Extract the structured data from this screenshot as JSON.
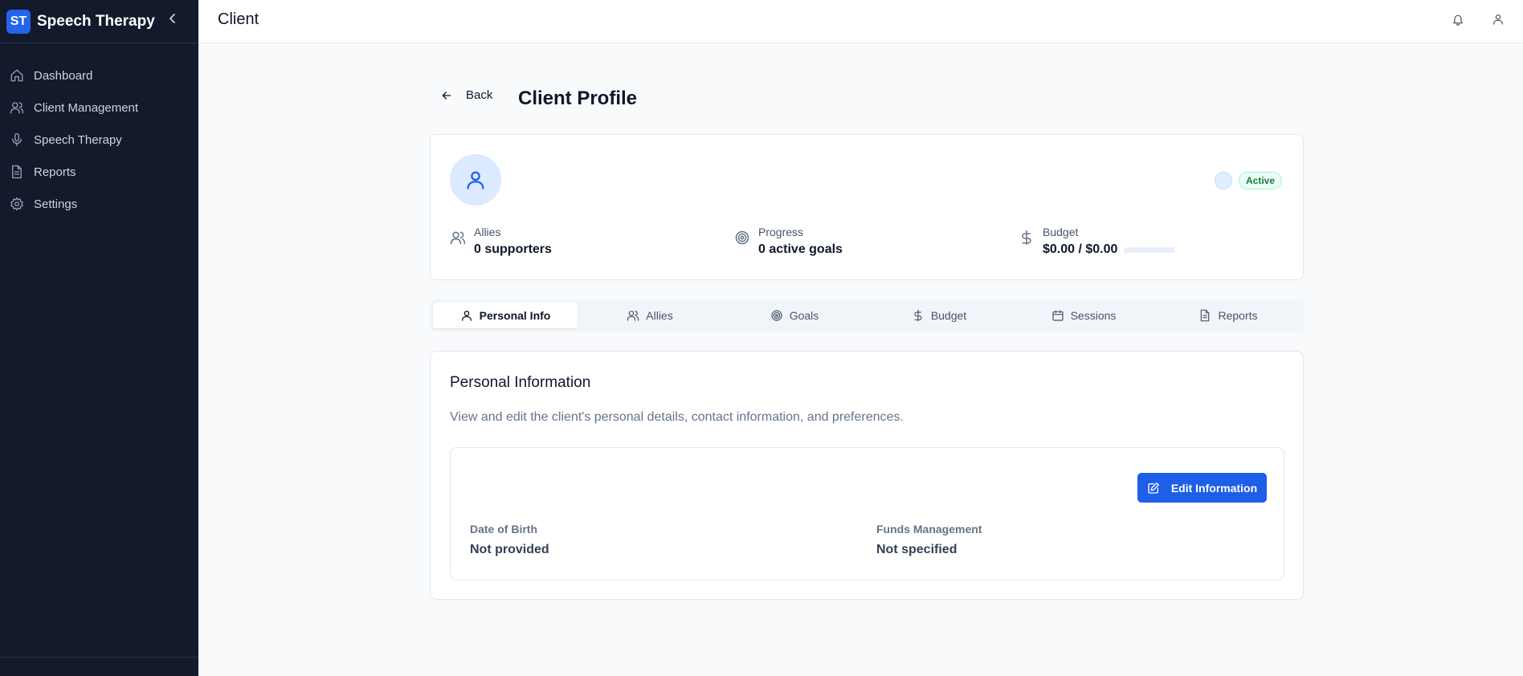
{
  "sidebar": {
    "logo": "ST",
    "app_name": "Speech Therapy",
    "items": [
      {
        "label": "Dashboard",
        "icon": "home-icon"
      },
      {
        "label": "Client Management",
        "icon": "users-icon"
      },
      {
        "label": "Speech Therapy",
        "icon": "mic-icon"
      },
      {
        "label": "Reports",
        "icon": "file-icon"
      },
      {
        "label": "Settings",
        "icon": "gear-icon"
      }
    ]
  },
  "header": {
    "title": "Client"
  },
  "page": {
    "back_label": "Back",
    "title": "Client Profile"
  },
  "profile": {
    "status": "Active",
    "stats": {
      "allies": {
        "label": "Allies",
        "value": "0 supporters"
      },
      "progress": {
        "label": "Progress",
        "value": "0 active goals"
      },
      "budget": {
        "label": "Budget",
        "value": "$0.00 / $0.00",
        "fill_fraction": 0
      }
    }
  },
  "tabs": [
    {
      "label": "Personal Info",
      "icon": "user-icon",
      "active": true
    },
    {
      "label": "Allies",
      "icon": "users-icon",
      "active": false
    },
    {
      "label": "Goals",
      "icon": "target-icon",
      "active": false
    },
    {
      "label": "Budget",
      "icon": "dollar-icon",
      "active": false
    },
    {
      "label": "Sessions",
      "icon": "calendar-icon",
      "active": false
    },
    {
      "label": "Reports",
      "icon": "file-icon",
      "active": false
    }
  ],
  "personal_info": {
    "title": "Personal Information",
    "description": "View and edit the client's personal details, contact information, and preferences.",
    "edit_label": "Edit Information",
    "fields": {
      "dob": {
        "label": "Date of Birth",
        "value": "Not provided"
      },
      "funds": {
        "label": "Funds Management",
        "value": "Not specified"
      }
    }
  },
  "colors": {
    "sidebar_bg": "#121a2b",
    "accent": "#2563eb",
    "status_green": "#15803d"
  }
}
